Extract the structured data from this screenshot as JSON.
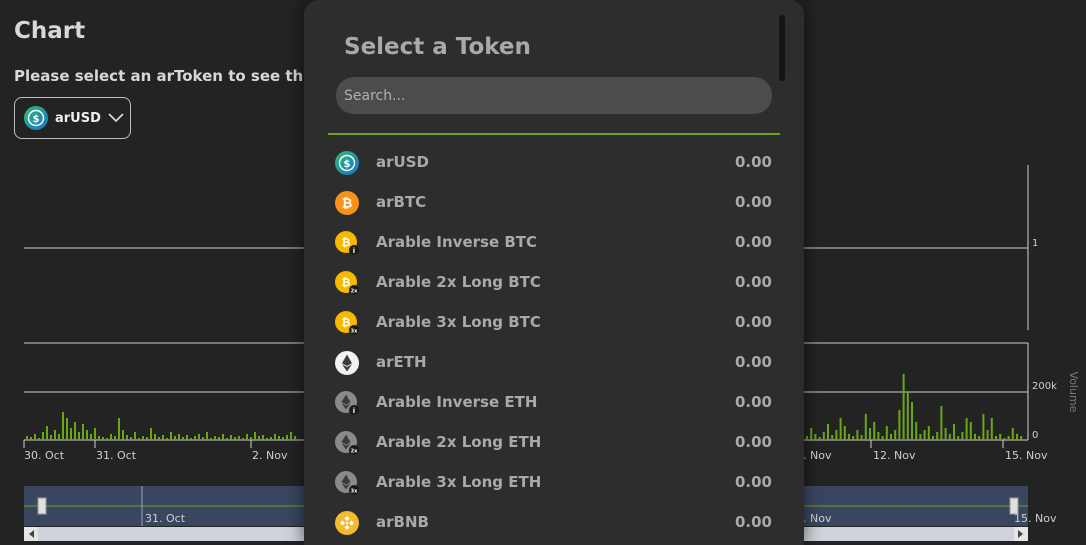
{
  "header": {
    "title": "Chart",
    "subtitle": "Please select an arToken to see the c"
  },
  "token_select": {
    "selected": "arUSD"
  },
  "chart": {
    "price_axis_label": "1",
    "volume_axis_label": "Volume",
    "volume_ticks": [
      "200k",
      "0"
    ],
    "x_ticks": [
      "30. Oct",
      "31. Oct",
      "2. Nov",
      ". Nov",
      "12. Nov",
      "15. Nov"
    ],
    "navigator_ticks": [
      "31. Oct",
      ". Nov",
      "15. Nov"
    ]
  },
  "modal": {
    "title": "Select a Token",
    "search_placeholder": "Search...",
    "tokens": [
      {
        "name": "arUSD",
        "balance": "0.00",
        "icon": "usd-coin-icon"
      },
      {
        "name": "arBTC",
        "balance": "0.00",
        "icon": "bitcoin-icon"
      },
      {
        "name": "Arable Inverse BTC",
        "balance": "0.00",
        "icon": "bitcoin-inverse-icon"
      },
      {
        "name": "Arable 2x Long BTC",
        "balance": "0.00",
        "icon": "bitcoin-2x-icon"
      },
      {
        "name": "Arable 3x Long BTC",
        "balance": "0.00",
        "icon": "bitcoin-3x-icon"
      },
      {
        "name": "arETH",
        "balance": "0.00",
        "icon": "ethereum-icon"
      },
      {
        "name": "Arable Inverse ETH",
        "balance": "0.00",
        "icon": "ethereum-inverse-icon"
      },
      {
        "name": "Arable 2x Long ETH",
        "balance": "0.00",
        "icon": "ethereum-2x-icon"
      },
      {
        "name": "Arable 3x Long ETH",
        "balance": "0.00",
        "icon": "ethereum-3x-icon"
      },
      {
        "name": "arBNB",
        "balance": "0.00",
        "icon": "bnb-icon"
      }
    ]
  },
  "colors": {
    "accent": "#6aa61a",
    "background": "#232323",
    "modal": "#2d2d2d"
  }
}
